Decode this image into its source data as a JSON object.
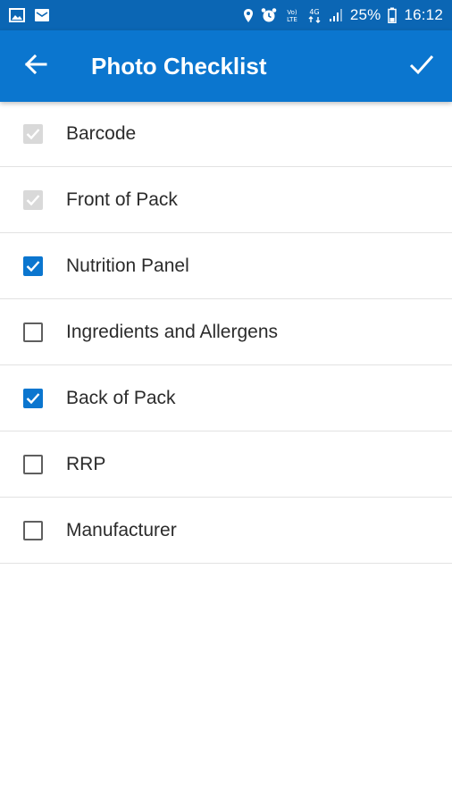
{
  "status_bar": {
    "battery_percent": "25%",
    "time": "16:12",
    "icons": [
      "gallery-icon",
      "message-icon",
      "location-icon",
      "alarm-icon",
      "volte-icon",
      "data-4g-icon",
      "signal-icon",
      "battery-icon"
    ]
  },
  "app_bar": {
    "title": "Photo Checklist",
    "back_icon": "arrow-left-icon",
    "confirm_icon": "check-icon"
  },
  "checklist": {
    "items": [
      {
        "label": "Barcode",
        "state": "disabled"
      },
      {
        "label": "Front of Pack",
        "state": "disabled"
      },
      {
        "label": "Nutrition Panel",
        "state": "checked"
      },
      {
        "label": "Ingredients and Allergens",
        "state": "unchecked"
      },
      {
        "label": "Back of Pack",
        "state": "checked"
      },
      {
        "label": "RRP",
        "state": "unchecked"
      },
      {
        "label": "Manufacturer",
        "state": "unchecked"
      }
    ]
  },
  "colors": {
    "status_bar": "#0b66b4",
    "app_bar": "#0b76cf",
    "checkbox_checked": "#0b76cf",
    "checkbox_disabled": "#d9d9d9"
  }
}
